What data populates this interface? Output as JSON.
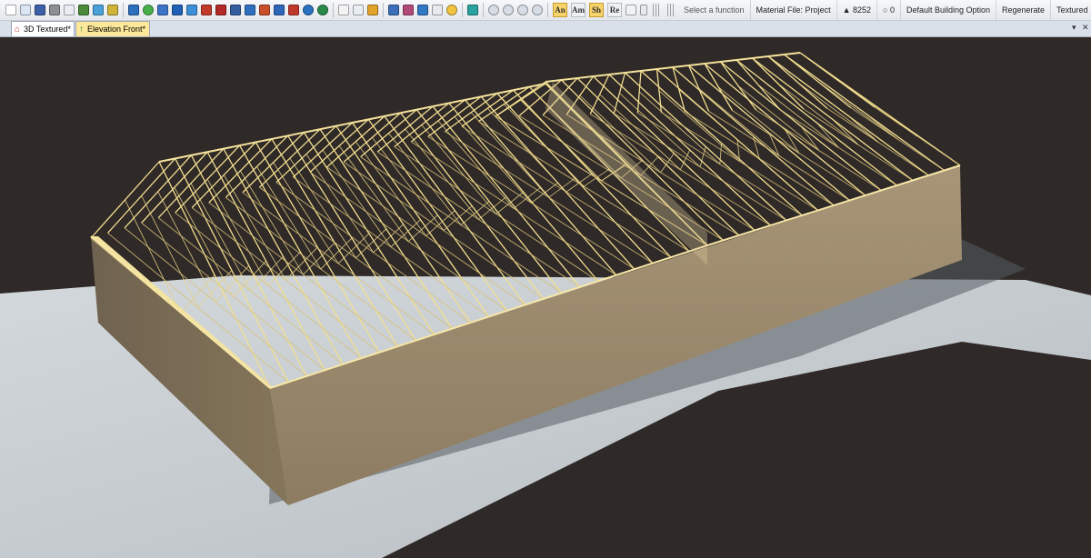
{
  "toolbar": {
    "function_hint": "Select a function",
    "material_file": "Material File: Project",
    "triangle_count": "▲ 8252",
    "zero_count": "○ 0",
    "building_option": "Default Building Option",
    "regenerate": "Regenerate",
    "render_mode": "Textured",
    "text_buttons": [
      "An",
      "Am",
      "Sh",
      "Re"
    ]
  },
  "tabs": [
    {
      "label": "3D Textured*",
      "icon": "house-icon"
    },
    {
      "label": "Elevation Front*",
      "icon": "arrow-up-icon"
    }
  ],
  "colors": {
    "toolbar_bg": "#eef0f3",
    "tab_active": "#fde89a",
    "ground": "#2f2927",
    "slab": "#c8ced2",
    "wall_front": "#9b8b6f",
    "wall_side": "#7d6e55",
    "truss": "#f0dc8c"
  }
}
